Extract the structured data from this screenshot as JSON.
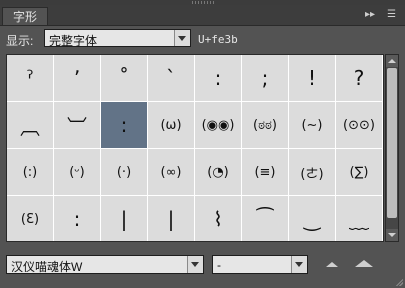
{
  "panel": {
    "tab_title": "字形",
    "menu_icons": [
      "double-arrow-icon",
      "panel-menu-icon"
    ]
  },
  "toolbar": {
    "show_label": "显示:",
    "show_value": "完整字体",
    "unicode": "U+fe3b"
  },
  "glyphs": [
    "ˀ",
    "ʼ",
    "˚",
    "ˋ",
    ":",
    ";",
    "!",
    "?",
    "︹",
    "︺",
    ":",
    "(ω)",
    "(◉◉)",
    "(ಠಠ)",
    "(~)",
    "(⊙⊙)",
    "(:)",
    "(ᵕ)",
    "(·)",
    "(∞)",
    "(◔)",
    "(≡)",
    "(ㄜ)",
    "(∑)",
    "(Ɛ)",
    ":",
    "|",
    "|",
    "⌇",
    "⁀",
    "‿",
    "﹏"
  ],
  "selected_index": 10,
  "footer": {
    "font_family": "汉仪喵魂体W",
    "font_style": "-"
  }
}
